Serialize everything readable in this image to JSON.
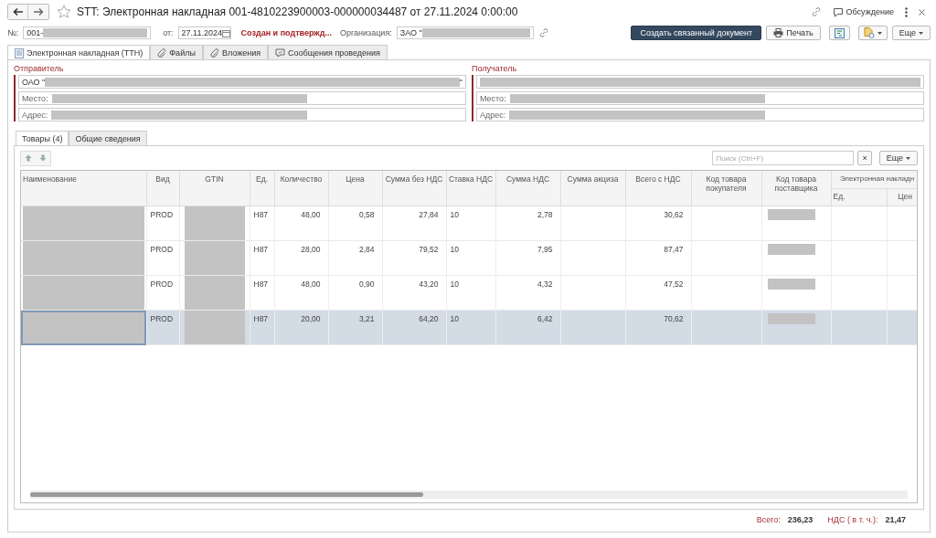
{
  "window": {
    "title": "STT: Электронная накладная 001-4810223900003-000000034487 от 27.11.2024 0:00:00",
    "discussion": "Обсуждение"
  },
  "toolbar": {
    "number_label": "№:",
    "number": {
      "prefix": "001-",
      "redacted": true
    },
    "date_label": "от:",
    "date": "27.11.2024",
    "status": "Создан и подтвержд...",
    "org_label": "Организация:",
    "org": {
      "prefix": "ЗАО \"",
      "redacted": true
    },
    "buttons": [
      {
        "kind": "primary",
        "label": "Создать связанный документ"
      },
      {
        "kind": "print",
        "label": "Печать"
      },
      {
        "kind": "structure"
      },
      {
        "kind": "attach-menu"
      },
      {
        "kind": "menu",
        "label": "Еще"
      }
    ]
  },
  "tabs": [
    {
      "label": "Электронная накладная (ТТН)",
      "selected": true
    },
    {
      "label": "Файлы",
      "selected": false
    },
    {
      "label": "Вложения",
      "selected": false
    },
    {
      "label": "Сообщения проведения",
      "selected": false
    }
  ],
  "parties": [
    {
      "title": "Отправитель",
      "name": {
        "prefix": "ОАО \"",
        "redacted": true,
        "suffix": "\""
      },
      "place_label": "Место:",
      "place": {
        "redacted": true
      },
      "address_label": "Адрес:",
      "address": {
        "redacted": true
      }
    },
    {
      "title": "Получатель",
      "name": {
        "redacted": true
      },
      "place_label": "Место:",
      "place": {
        "redacted": true
      },
      "address_label": "Адрес:",
      "address": {
        "redacted": true
      }
    }
  ],
  "subtabs": [
    {
      "label": "Товары (4)",
      "selected": true
    },
    {
      "label": "Общие сведения",
      "selected": false
    }
  ],
  "table_toolbar": {
    "search_placeholder": "Поиск (Ctrl+F)",
    "clear": "×",
    "more": "Еще"
  },
  "table": {
    "columns": [
      {
        "label": "Наименование"
      },
      {
        "label": "Вид"
      },
      {
        "label": "GTIN"
      },
      {
        "label": "Ед."
      },
      {
        "label": "Количество"
      },
      {
        "label": "Цена"
      },
      {
        "label": "Сумма без НДС"
      },
      {
        "label": "Ставка НДС"
      },
      {
        "label": "Сумма НДС"
      },
      {
        "label": "Сумма акциза"
      },
      {
        "label": "Всего с НДС"
      },
      {
        "label": "Код товара покупателя"
      },
      {
        "label": "Код товара поставщика"
      },
      {
        "label": "Электронная накладн",
        "children": [
          {
            "label": "Ед."
          },
          {
            "label": "Цен"
          }
        ]
      }
    ],
    "rows": [
      {
        "selected": false,
        "cells": [
          {
            "kind": "redacted"
          },
          {
            "kind": "text",
            "text": "PROD"
          },
          {
            "kind": "redacted"
          },
          {
            "kind": "text",
            "text": "H87"
          },
          {
            "kind": "number",
            "text": "48,00"
          },
          {
            "kind": "number",
            "text": "0,58"
          },
          {
            "kind": "number",
            "text": "27,84"
          },
          {
            "kind": "text",
            "text": "10"
          },
          {
            "kind": "number",
            "text": "2,78"
          },
          {
            "kind": "empty"
          },
          {
            "kind": "number",
            "text": "30,62"
          },
          {
            "kind": "empty"
          },
          {
            "kind": "redacted"
          },
          {
            "kind": "empty"
          },
          {
            "kind": "empty"
          }
        ]
      },
      {
        "selected": false,
        "cells": [
          {
            "kind": "redacted"
          },
          {
            "kind": "text",
            "text": "PROD"
          },
          {
            "kind": "redacted"
          },
          {
            "kind": "text",
            "text": "H87"
          },
          {
            "kind": "number",
            "text": "28,00"
          },
          {
            "kind": "number",
            "text": "2,84"
          },
          {
            "kind": "number",
            "text": "79,52"
          },
          {
            "kind": "text",
            "text": "10"
          },
          {
            "kind": "number",
            "text": "7,95"
          },
          {
            "kind": "empty"
          },
          {
            "kind": "number",
            "text": "87,47"
          },
          {
            "kind": "empty"
          },
          {
            "kind": "redacted"
          },
          {
            "kind": "empty"
          },
          {
            "kind": "empty"
          }
        ]
      },
      {
        "selected": false,
        "cells": [
          {
            "kind": "redacted"
          },
          {
            "kind": "text",
            "text": "PROD"
          },
          {
            "kind": "redacted"
          },
          {
            "kind": "text",
            "text": "H87"
          },
          {
            "kind": "number",
            "text": "48,00"
          },
          {
            "kind": "number",
            "text": "0,90"
          },
          {
            "kind": "number",
            "text": "43,20"
          },
          {
            "kind": "text",
            "text": "10"
          },
          {
            "kind": "number",
            "text": "4,32"
          },
          {
            "kind": "empty"
          },
          {
            "kind": "number",
            "text": "47,52"
          },
          {
            "kind": "empty"
          },
          {
            "kind": "redacted"
          },
          {
            "kind": "empty"
          },
          {
            "kind": "empty"
          }
        ]
      },
      {
        "selected": true,
        "cells": [
          {
            "kind": "redacted"
          },
          {
            "kind": "text",
            "text": "PROD"
          },
          {
            "kind": "redacted"
          },
          {
            "kind": "text",
            "text": "H87"
          },
          {
            "kind": "number",
            "text": "20,00"
          },
          {
            "kind": "number",
            "text": "3,21"
          },
          {
            "kind": "number",
            "text": "64,20"
          },
          {
            "kind": "text",
            "text": "10"
          },
          {
            "kind": "number",
            "text": "6,42"
          },
          {
            "kind": "empty"
          },
          {
            "kind": "number",
            "text": "70,62"
          },
          {
            "kind": "empty"
          },
          {
            "kind": "redacted"
          },
          {
            "kind": "empty"
          },
          {
            "kind": "empty"
          }
        ]
      }
    ]
  },
  "totals": {
    "total_label": "Всего:",
    "total": "236,23",
    "vat_label": "НДС ( в т. ч.):",
    "vat": "21,47"
  }
}
